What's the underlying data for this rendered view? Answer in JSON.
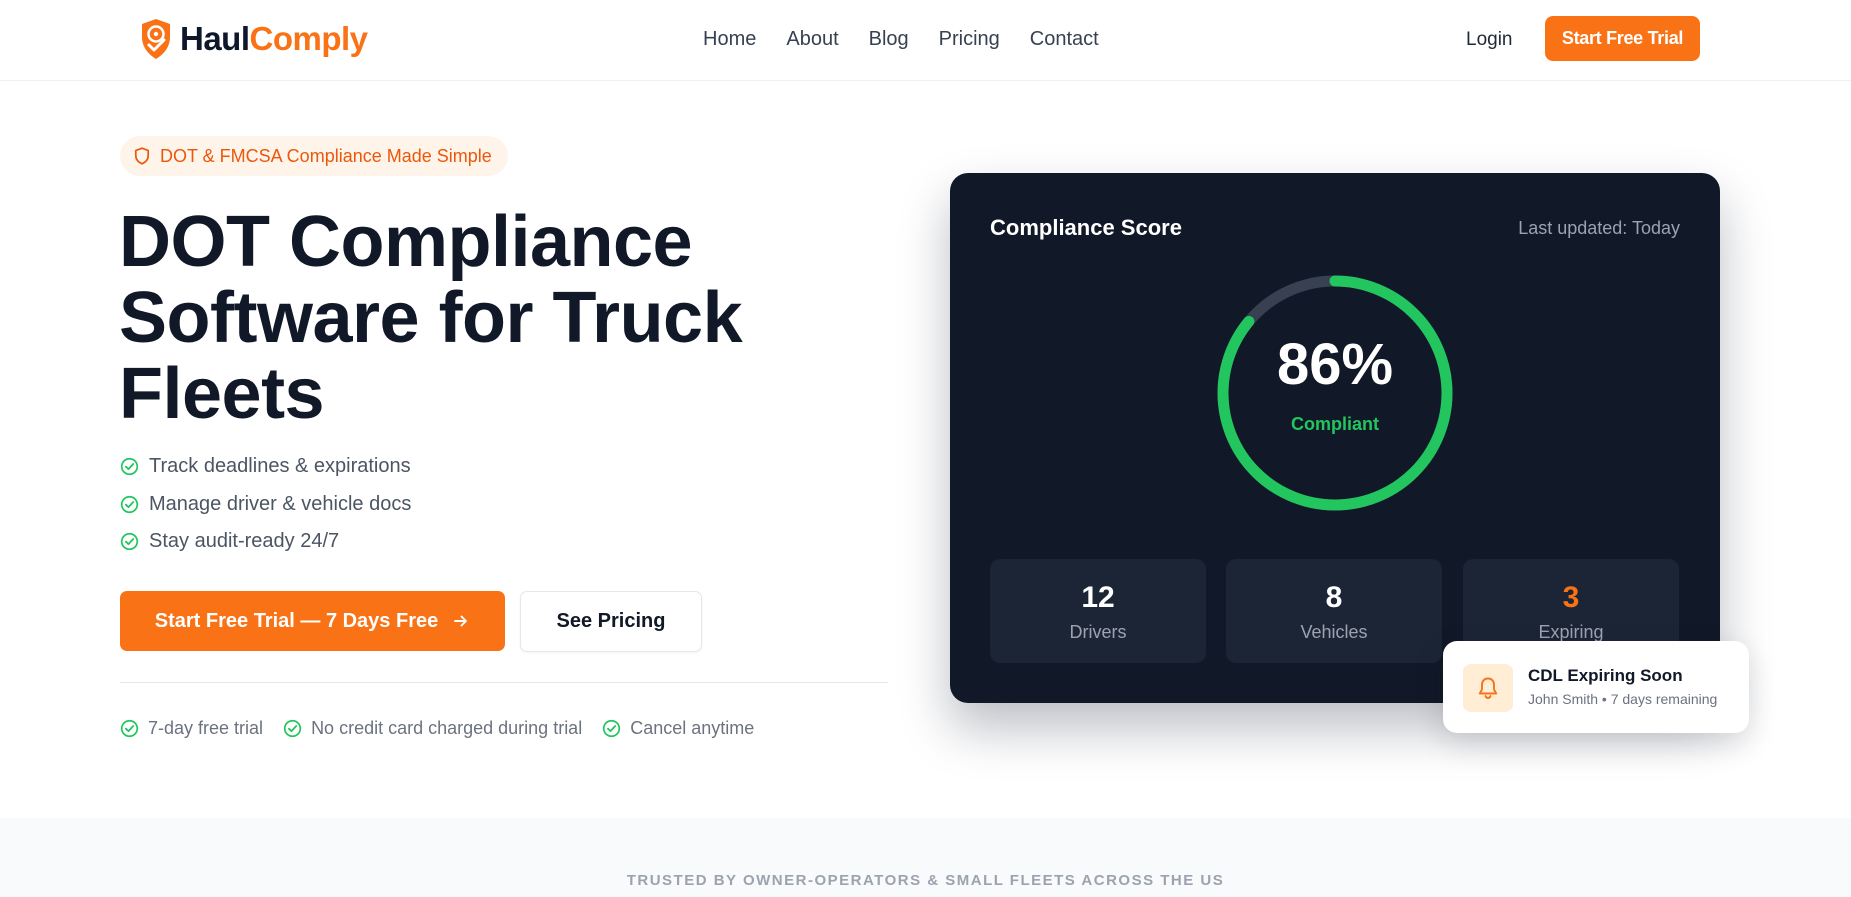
{
  "colors": {
    "brand": "#f97316",
    "brand_dark": "#ea580c",
    "success": "#22c55e",
    "card_bg": "#111827"
  },
  "header": {
    "logo": {
      "part1": "Haul",
      "part2": "Comply",
      "icon": "shield-check-icon"
    },
    "nav": [
      "Home",
      "About",
      "Blog",
      "Pricing",
      "Contact"
    ],
    "login_label": "Login",
    "cta_label": "Start Free Trial"
  },
  "hero": {
    "badge": {
      "icon": "shield-icon",
      "text": "DOT & FMCSA Compliance Made Simple"
    },
    "title": "DOT Compliance Software for Truck Fleets",
    "features": [
      "Track deadlines & expirations",
      "Manage driver & vehicle docs",
      "Stay audit-ready 24/7"
    ],
    "primary_cta": "Start Free Trial — 7 Days Free",
    "secondary_cta": "See Pricing",
    "perks": [
      "7-day free trial",
      "No credit card charged during trial",
      "Cancel anytime"
    ]
  },
  "dashboard": {
    "title": "Compliance Score",
    "updated": "Last updated: Today",
    "score": {
      "value": "86%",
      "fraction": 0.86,
      "label": "Compliant"
    },
    "stats": [
      {
        "value": "12",
        "label": "Drivers",
        "color": "#ffffff"
      },
      {
        "value": "8",
        "label": "Vehicles",
        "color": "#ffffff"
      },
      {
        "value": "3",
        "label": "Expiring",
        "color": "#f97316"
      }
    ]
  },
  "notification": {
    "icon": "bell-icon",
    "title": "CDL Expiring Soon",
    "subtitle": "John Smith • 7 days remaining"
  },
  "trusted": {
    "text": "TRUSTED BY OWNER-OPERATORS & SMALL FLEETS ACROSS THE US"
  }
}
